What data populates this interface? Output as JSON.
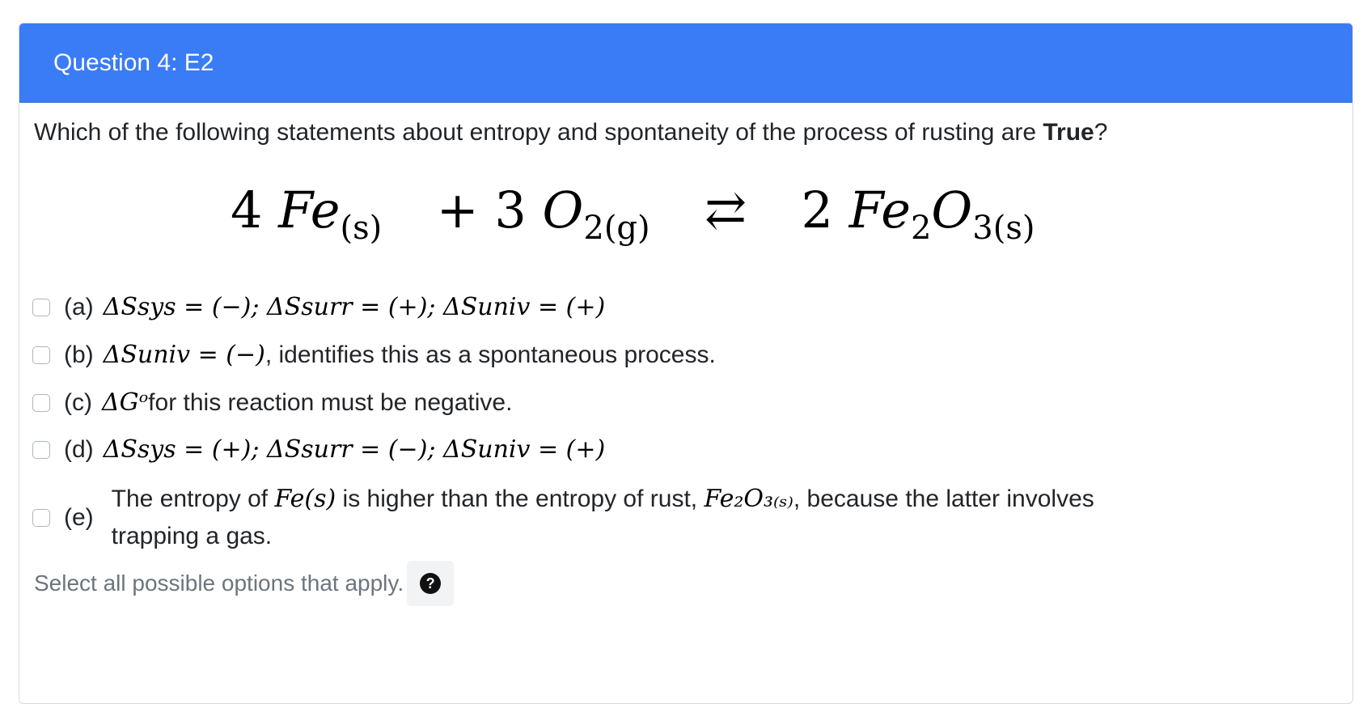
{
  "question": {
    "title": "Question 4: E2",
    "prompt_pre": "Which of the following statements about entropy and spontaneity of the process of rusting are ",
    "prompt_bold": "True",
    "prompt_post": "?"
  },
  "equation": {
    "c1": "4",
    "s1": "Fe",
    "p1": "(s)",
    "plus": "+",
    "c2": "3",
    "s2": "O",
    "p2": "2(g)",
    "arrow": "⇄",
    "c3": "2",
    "s3a": "Fe",
    "p3a": "2",
    "s3b": "O",
    "p3b": "3(s)"
  },
  "options": [
    {
      "label": "(a)",
      "math": "ΔSsys = (−);  ΔSsurr = (+);  ΔSuniv = (+)"
    },
    {
      "label": "(b)",
      "math": "ΔSuniv = (−)",
      "text": ", identifies this as a spontaneous process."
    },
    {
      "label": "(c)",
      "math": "ΔGᵒ",
      "text": " for this reaction must be negative."
    },
    {
      "label": "(d)",
      "math": "ΔSsys = (+);  ΔSsurr = (−);  ΔSuniv = (+)"
    },
    {
      "label": "(e)",
      "t1": "The entropy of ",
      "m1": "Fe(s)",
      "t2": " is higher than the entropy of rust, ",
      "m2": "Fe₂O₃₍ₛ₎",
      "t3": ", because the latter involves trapping a gas."
    }
  ],
  "hint": "Select all possible options that apply.",
  "help_icon": "question-mark-circle",
  "help_glyph": "?"
}
